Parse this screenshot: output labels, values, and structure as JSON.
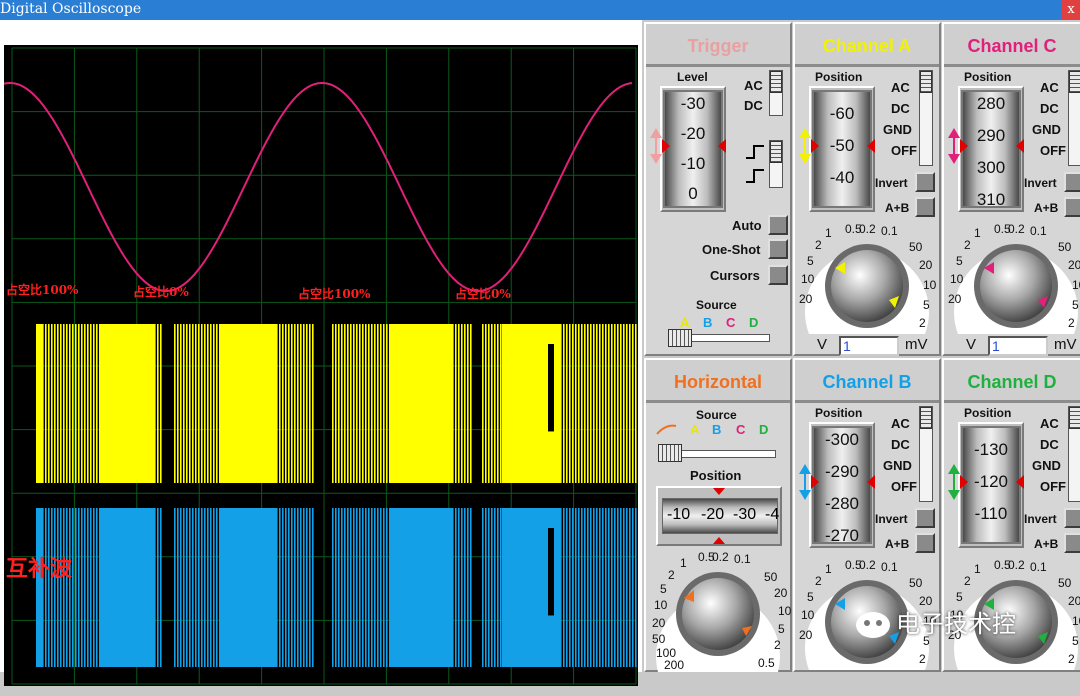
{
  "window": {
    "title": "Digital Oscilloscope",
    "close_glyph": "x"
  },
  "screen": {
    "annotations": [
      "占空比100%",
      "占空比0%",
      "占空比100%",
      "占空比0%"
    ],
    "side_label": "互补波",
    "traces": {
      "channel_a_color": "#e0207a",
      "channel_c_color": "#ffff00",
      "channel_b_color": "#14a0e6"
    }
  },
  "trigger": {
    "title": "Trigger",
    "title_color": "#e8a0a0",
    "level_label": "Level",
    "level_ticks": [
      "-30",
      "-20",
      "-10",
      "0"
    ],
    "coupling": [
      "AC",
      "DC"
    ],
    "buttons": [
      "Auto",
      "One-Shot",
      "Cursors"
    ],
    "source_label": "Source",
    "sources": [
      "A",
      "B",
      "C",
      "D"
    ]
  },
  "channel_a": {
    "title": "Channel A",
    "title_color": "#f2f200",
    "position_label": "Position",
    "position_ticks": [
      "-60",
      "-50",
      "-40"
    ],
    "modes": [
      "AC",
      "DC",
      "GND",
      "OFF"
    ],
    "invert_label": "Invert",
    "sum_label": "A+B",
    "dial_scale": [
      "0.5",
      "0.2",
      "0.1",
      "50",
      "20",
      "10",
      "5",
      "2",
      "1",
      "2",
      "5",
      "10",
      "20"
    ],
    "units": [
      "V",
      "mV"
    ],
    "value": "1"
  },
  "channel_c": {
    "title": "Channel C",
    "title_color": "#e0207a",
    "position_label": "Position",
    "position_ticks": [
      "280",
      "290",
      "300",
      "310"
    ],
    "modes": [
      "AC",
      "DC",
      "GND",
      "OFF"
    ],
    "invert_label": "Invert",
    "sum_label": "A+B",
    "dial_scale": [
      "0.5",
      "0.2",
      "0.1",
      "50",
      "20",
      "10",
      "5",
      "2",
      "1",
      "2",
      "5",
      "10",
      "20"
    ],
    "units": [
      "V",
      "mV"
    ],
    "value": "1"
  },
  "horizontal": {
    "title": "Horizontal",
    "title_color": "#f07020",
    "source_label": "Source",
    "sources": [
      "A",
      "B",
      "C",
      "D"
    ],
    "position_label": "Position",
    "position_ticks": [
      "-10",
      "-20",
      "-30",
      "-4"
    ],
    "dial_scale": [
      "0.5",
      "0.2",
      "0.1",
      "50",
      "20",
      "10",
      "5",
      "2",
      "1",
      "2",
      "5",
      "10",
      "20",
      "50",
      "100",
      "200",
      "0.5"
    ]
  },
  "channel_b": {
    "title": "Channel B",
    "title_color": "#14a0e6",
    "position_label": "Position",
    "position_ticks": [
      "-300",
      "-290",
      "-280",
      "-270"
    ],
    "modes": [
      "AC",
      "DC",
      "GND",
      "OFF"
    ],
    "invert_label": "Invert",
    "sum_label": "A+B",
    "dial_scale": [
      "0.5",
      "0.2",
      "0.1",
      "50",
      "20",
      "10",
      "5",
      "2",
      "1",
      "2",
      "5",
      "10",
      "20"
    ]
  },
  "channel_d": {
    "title": "Channel D",
    "title_color": "#20b040",
    "position_label": "Position",
    "position_ticks": [
      "-130",
      "-120",
      "-110"
    ],
    "modes": [
      "AC",
      "DC",
      "GND",
      "OFF"
    ],
    "invert_label": "Invert",
    "sum_label": "A+B",
    "dial_scale": [
      "0.5",
      "0.2",
      "0.1",
      "50",
      "20",
      "10",
      "5",
      "2",
      "1",
      "2",
      "5",
      "10",
      "20"
    ]
  },
  "watermark": "电子技术控"
}
